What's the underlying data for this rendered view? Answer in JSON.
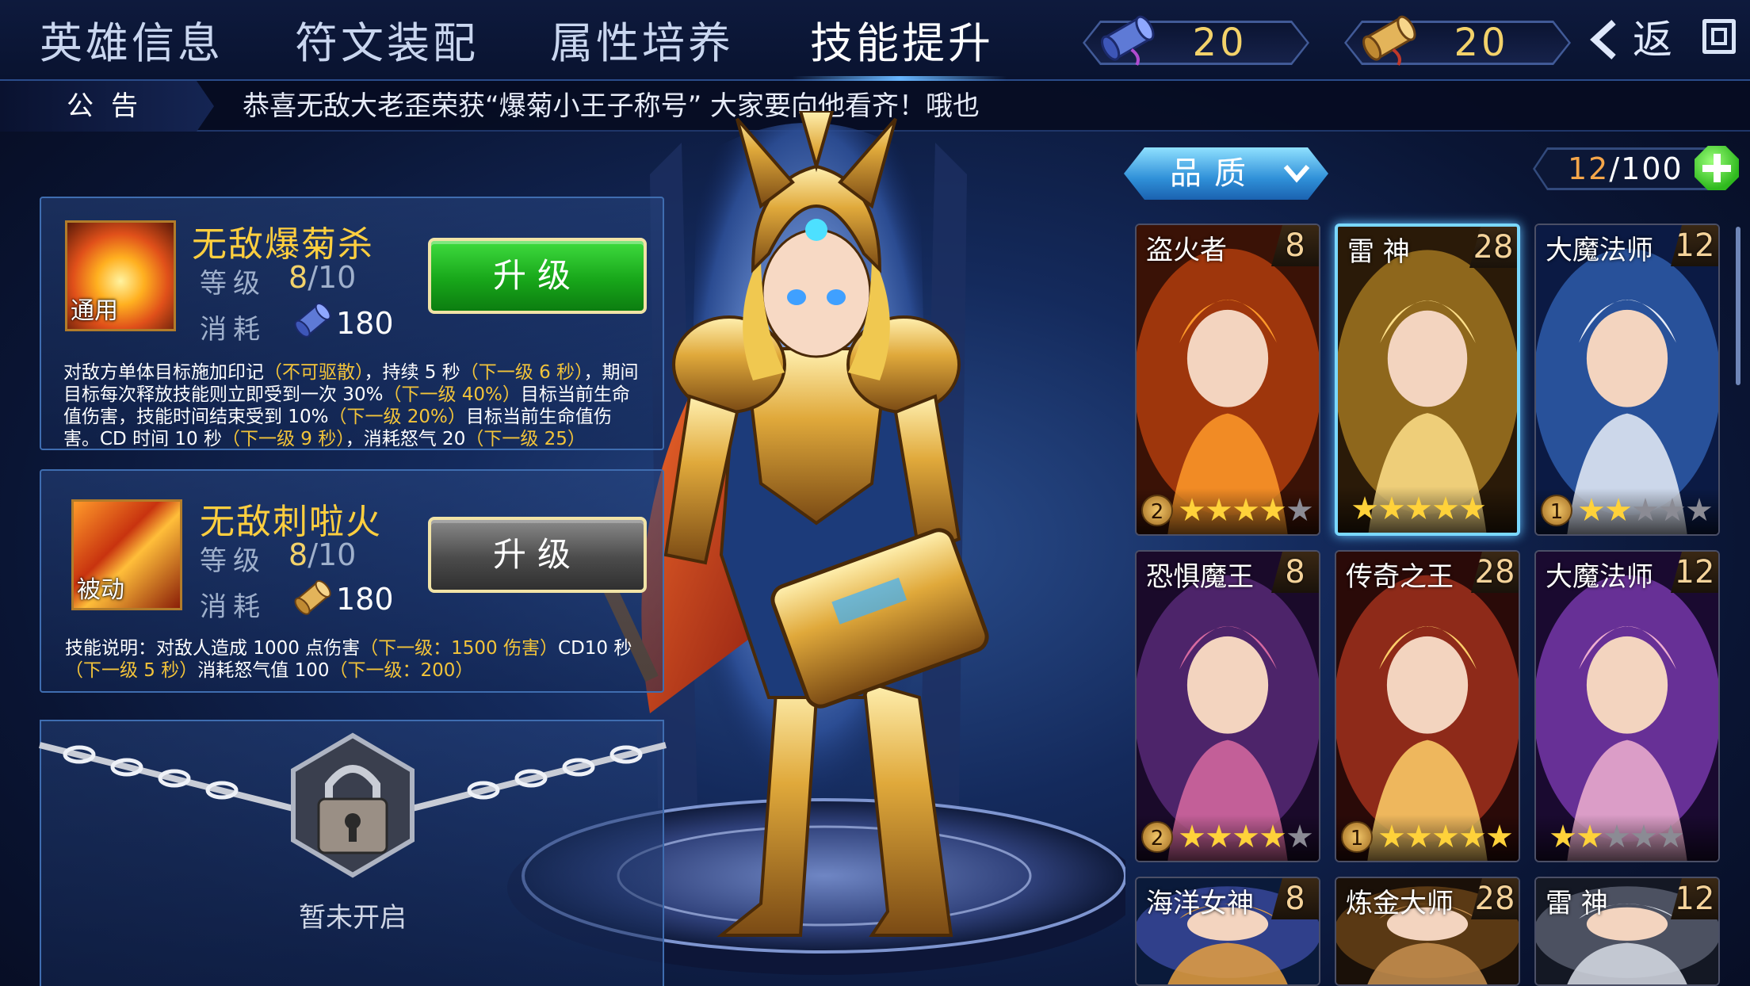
{
  "tabs": [
    {
      "label": "英雄信息"
    },
    {
      "label": "符文装配"
    },
    {
      "label": "属性培养"
    },
    {
      "label": "技能提升",
      "active": true
    }
  ],
  "currency": {
    "blue_scroll": "20",
    "gold_scroll": "20"
  },
  "back_label": "返",
  "notice": {
    "label": "公告",
    "text": "恭喜无敌大老歪荣获“爆菊小王子称号”  大家要向他看齐！哦也"
  },
  "skills": [
    {
      "name": "无敌爆菊杀",
      "tag": "通用",
      "level_label": "等级",
      "level": "8",
      "level_max": "/10",
      "cost_label": "消耗",
      "cost": "180",
      "button": "升级",
      "desc_parts": [
        {
          "t": "对敌方单体目标施加印记",
          "y": false
        },
        {
          "t": "（不可驱散）",
          "y": true
        },
        {
          "t": "，持续 5 秒",
          "y": false
        },
        {
          "t": "（下一级 6 秒）",
          "y": true
        },
        {
          "t": "，期间目标每次释放技能则立即受到一次 30%",
          "y": false
        },
        {
          "t": "（下一级 40%）",
          "y": true
        },
        {
          "t": "目标当前生命值伤害，技能时间结束受到 10%",
          "y": false
        },
        {
          "t": "（下一级 20%）",
          "y": true
        },
        {
          "t": "目标当前生命值伤害。CD 时间 10 秒",
          "y": false
        },
        {
          "t": "（下一级 9 秒）",
          "y": true
        },
        {
          "t": "，消耗怒气 20",
          "y": false
        },
        {
          "t": "（下一级 25）",
          "y": true
        }
      ]
    },
    {
      "name": "无敌刺啦火",
      "tag": "被动",
      "level_label": "等级",
      "level": "8",
      "level_max": "/10",
      "cost_label": "消耗",
      "cost": "180",
      "button": "升级",
      "desc_parts": [
        {
          "t": "技能说明：对敌人造成 1000 点伤害",
          "y": false
        },
        {
          "t": "（下一级：1500 伤害）",
          "y": true
        },
        {
          "t": "CD10 秒",
          "y": false
        },
        {
          "t": "（下一级 5 秒）",
          "y": true
        },
        {
          "t": "消耗怒气值 100",
          "y": false
        },
        {
          "t": "（下一级：200）",
          "y": true
        }
      ]
    }
  ],
  "locked_label": "暂未开启",
  "quality_label": "品质",
  "hero_count": {
    "current": "12",
    "max": "/100"
  },
  "colors": {
    "accent_gold": "#ffcf3f",
    "highlight_yellow": "#f3c43a",
    "upgrade_green": "#18a71a",
    "selected_border": "#7ad8ff"
  },
  "heroes": [
    {
      "name": "盗火者",
      "level": "8",
      "grade": "2",
      "stars": 4,
      "theme": "fire"
    },
    {
      "name": "雷 神",
      "level": "28",
      "grade": "",
      "stars": 5,
      "theme": "gold",
      "selected": true
    },
    {
      "name": "大魔法师",
      "level": "12",
      "grade": "1",
      "stars": 2,
      "theme": "blue"
    },
    {
      "name": "恐惧魔王",
      "level": "8",
      "grade": "2",
      "stars": 4,
      "theme": "purple"
    },
    {
      "name": "传奇之王",
      "level": "28",
      "grade": "1",
      "stars": 5,
      "theme": "red"
    },
    {
      "name": "大魔法师",
      "level": "12",
      "grade": "",
      "stars": 2,
      "theme": "violet"
    },
    {
      "name": "海洋女神",
      "level": "8",
      "grade": "",
      "stars": 0,
      "theme": "ocean"
    },
    {
      "name": "炼金大师",
      "level": "28",
      "grade": "",
      "stars": 0,
      "theme": "brown"
    },
    {
      "name": "雷 神",
      "level": "12",
      "grade": "",
      "stars": 0,
      "theme": "silver"
    }
  ]
}
